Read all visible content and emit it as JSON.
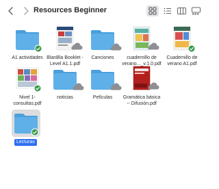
{
  "window": {
    "title": "Resources Beginner"
  },
  "toolbar": {
    "back_icon": "chevron-left-icon",
    "forward_icon": "chevron-right-icon",
    "views": [
      "grid-view-icon",
      "list-view-icon",
      "column-view-icon",
      "gallery-view-icon"
    ],
    "active_view": "grid-view-icon"
  },
  "files": [
    {
      "name_lines": [
        "A1 actividades"
      ],
      "kind": "folder",
      "status": "synced"
    },
    {
      "name_lines": [
        "BlanBla Booklet -",
        "Level A1.1.pdf"
      ],
      "kind": "pdf",
      "status": "cloud"
    },
    {
      "name_lines": [
        "Canciones"
      ],
      "kind": "folder",
      "status": "cloud"
    },
    {
      "name_lines": [
        "cuadernillo de",
        "verano..._v.1.0.pdf"
      ],
      "kind": "pdf",
      "status": "cloud"
    },
    {
      "name_lines": [
        "Cuadernillo de",
        "verano A1.pdf"
      ],
      "kind": "pdf",
      "status": "synced"
    },
    {
      "name_lines": [
        "Nivel 1-",
        "consultas.pdf"
      ],
      "kind": "pdf",
      "status": "synced"
    },
    {
      "name_lines": [
        "noticias"
      ],
      "kind": "folder",
      "status": "cloud"
    },
    {
      "name_lines": [
        "Películas"
      ],
      "kind": "folder",
      "status": "cloud"
    },
    {
      "name_lines": [
        "Gramática básica",
        "-- Difusión.pdf"
      ],
      "kind": "pdf",
      "status": "cloud"
    },
    {
      "name_lines": [
        "Lecturas"
      ],
      "kind": "folder",
      "status": "synced",
      "selected": true
    }
  ],
  "colors": {
    "folder": "#5fb0e8",
    "folder_tab": "#4a9fdc",
    "selection": "#2e6ff0",
    "synced_badge": "#3a9a4c"
  }
}
